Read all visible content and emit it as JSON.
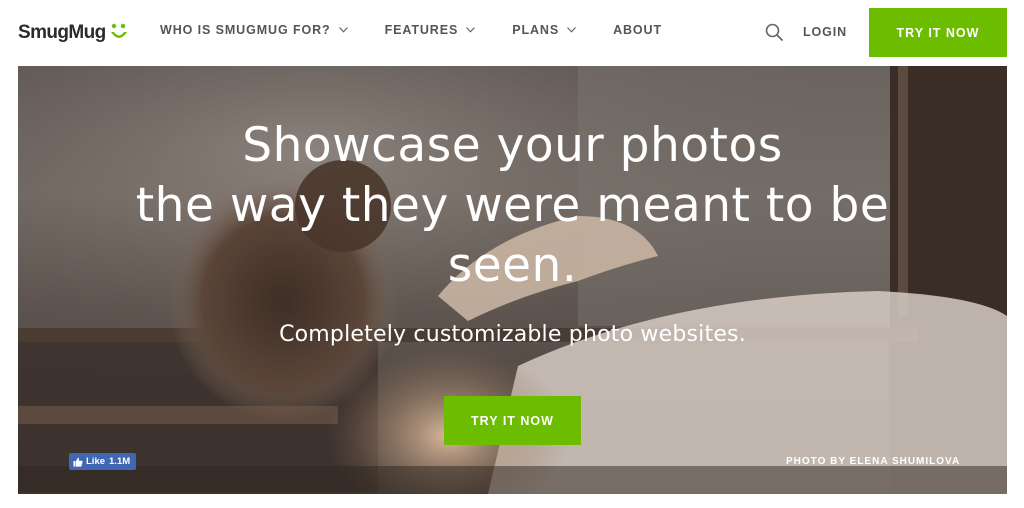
{
  "header": {
    "logo_text": "SmugMug",
    "nav": [
      {
        "label": "WHO IS SMUGMUG FOR?",
        "has_dropdown": true
      },
      {
        "label": "FEATURES",
        "has_dropdown": true
      },
      {
        "label": "PLANS",
        "has_dropdown": true
      },
      {
        "label": "ABOUT",
        "has_dropdown": false
      }
    ],
    "search_icon": "search-icon",
    "login_label": "LOGIN",
    "cta_label": "TRY IT NOW"
  },
  "hero": {
    "headline_lines": [
      "Showcase your photos",
      "the way they were meant to be",
      "seen."
    ],
    "subheadline": "Completely customizable photo websites.",
    "cta_label": "TRY IT NOW",
    "photo_credit": "PHOTO BY ELENA SHUMILOVA",
    "fb_like": {
      "label": "Like",
      "count": "1.1M"
    }
  },
  "colors": {
    "accent_green": "#6cbd00",
    "facebook_blue": "#4267b2",
    "nav_text": "#555555"
  }
}
